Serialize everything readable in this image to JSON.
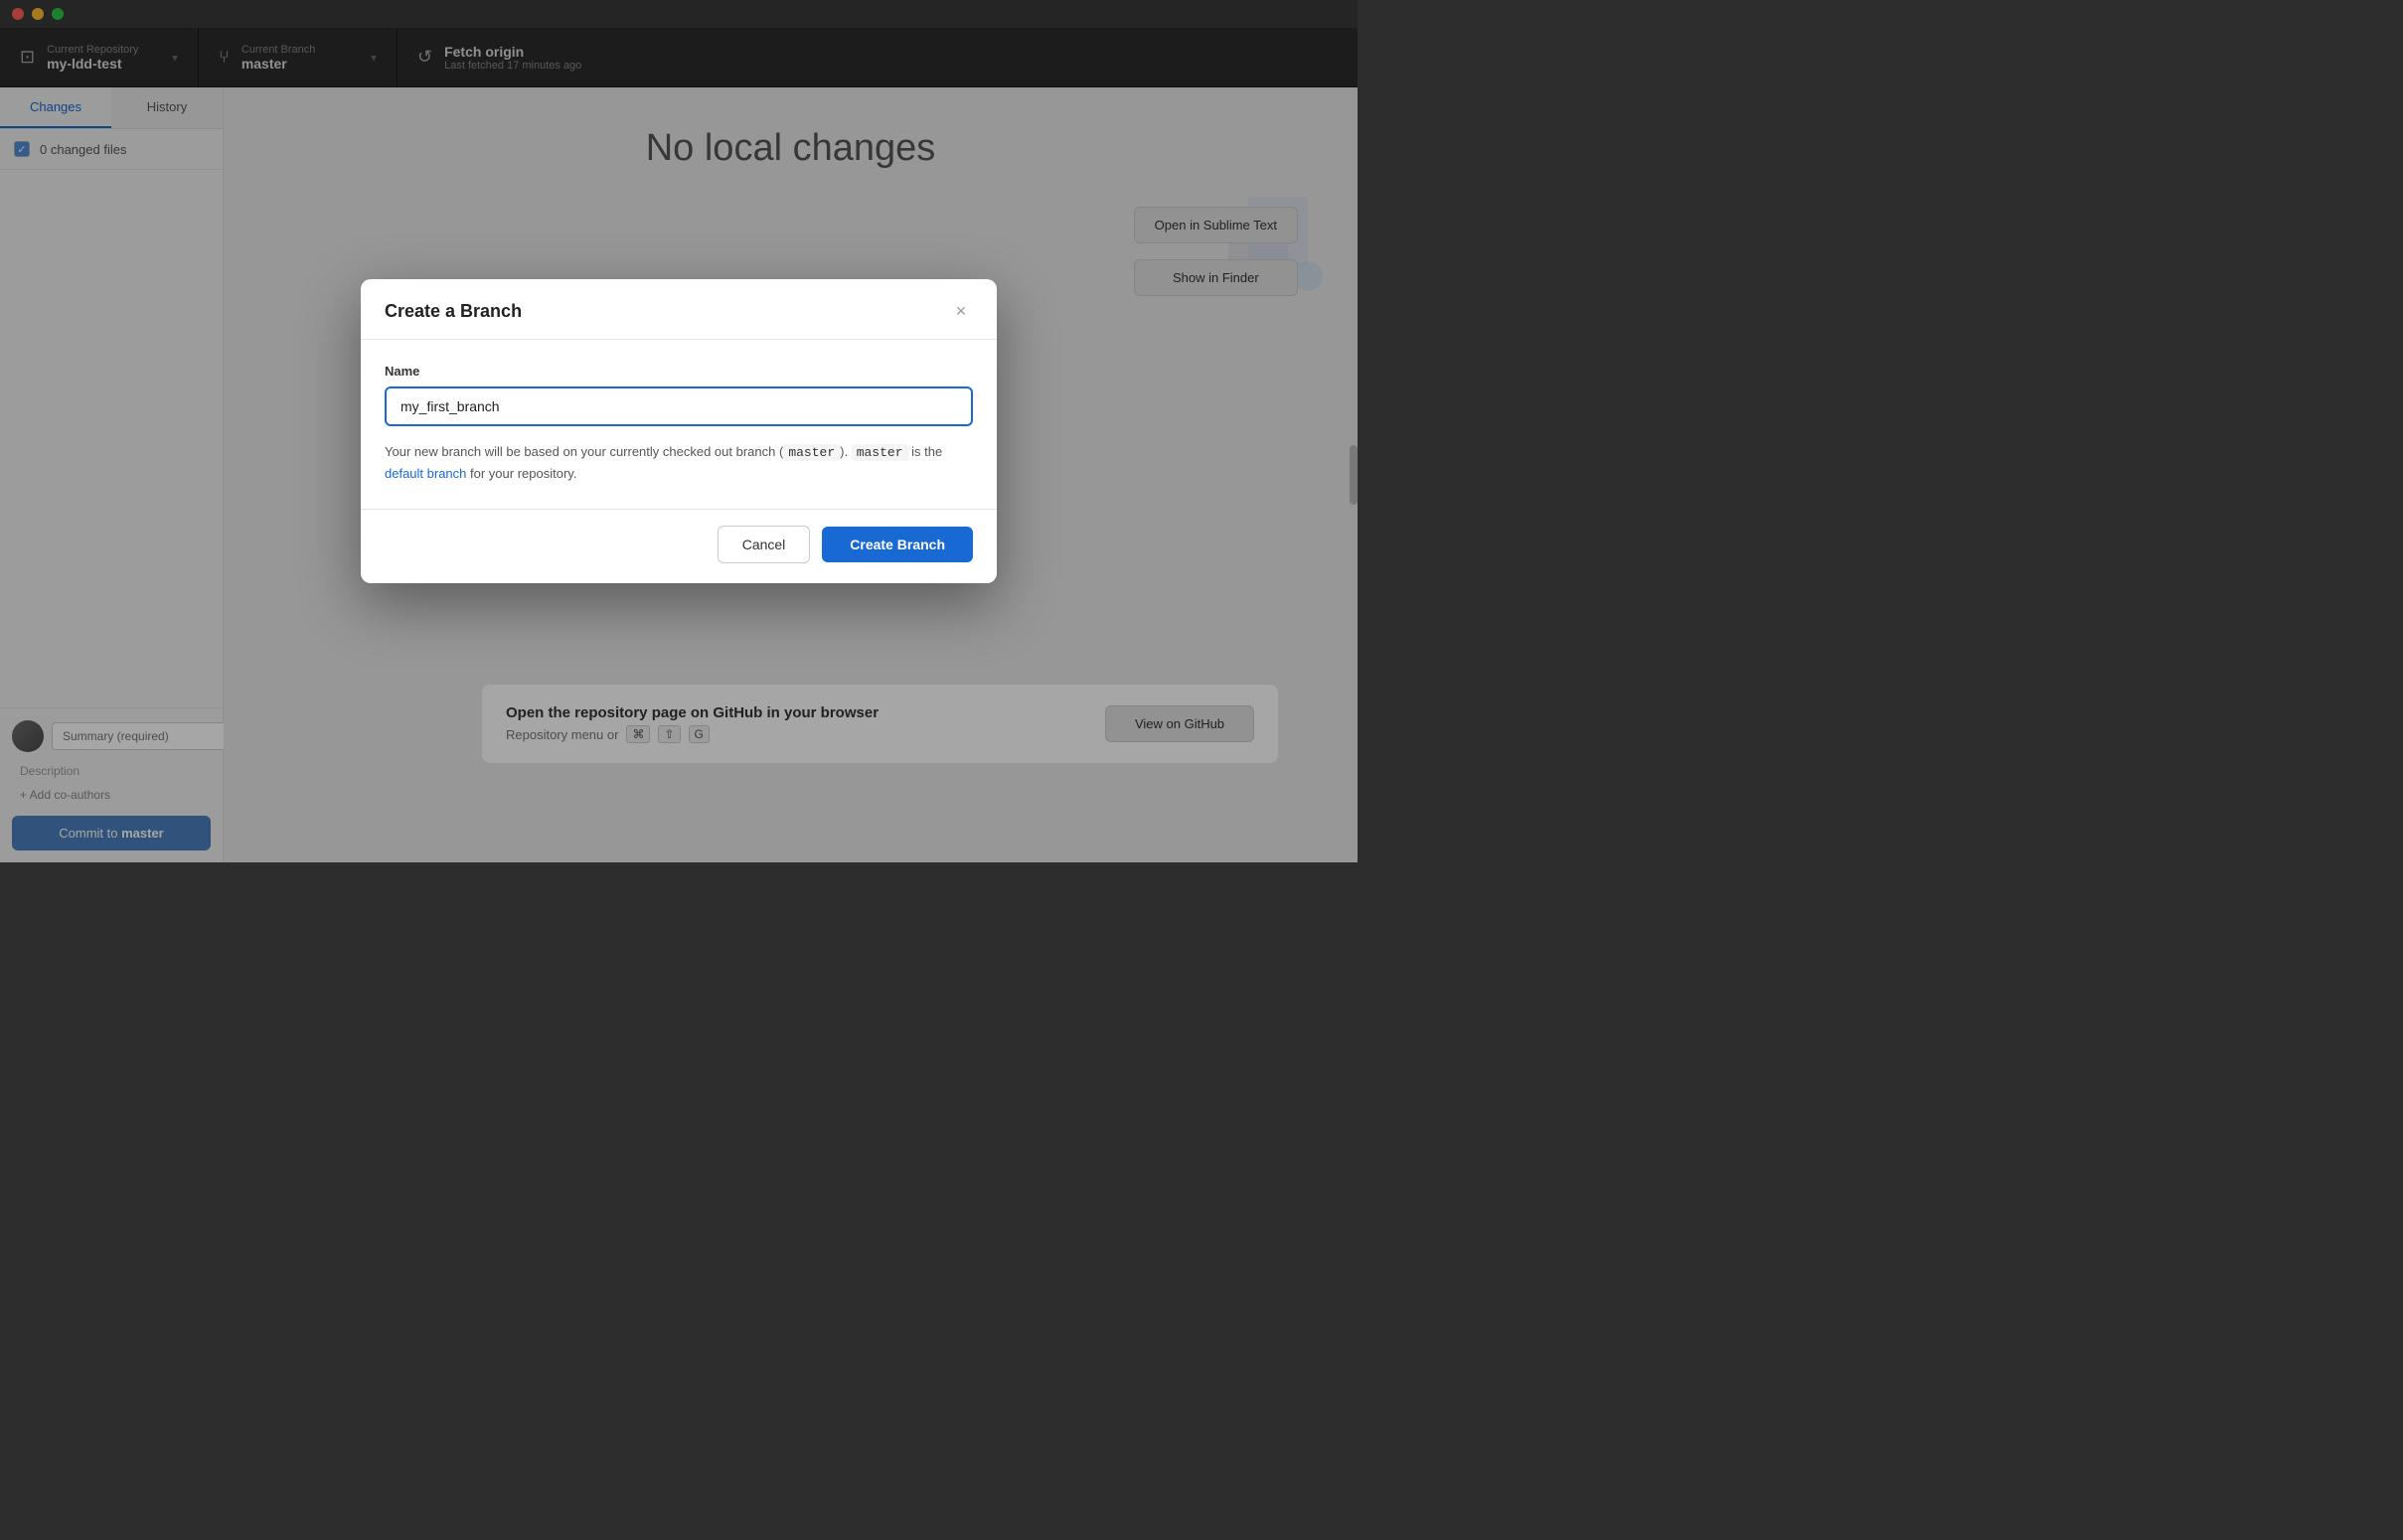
{
  "titlebar": {
    "buttons": [
      "close",
      "minimize",
      "maximize"
    ]
  },
  "toolbar": {
    "repo_section": {
      "label": "Current Repository",
      "value": "my-ldd-test",
      "chevron": "▾"
    },
    "branch_section": {
      "label": "Current Branch",
      "value": "master",
      "chevron": "▾"
    },
    "fetch_section": {
      "label": "Fetch origin",
      "sublabel": "Last fetched 17 minutes ago",
      "icon": "↺"
    }
  },
  "sidebar": {
    "tab_changes": "Changes",
    "tab_history": "History",
    "changed_files_count": "0 changed files",
    "summary_placeholder": "Summary (required)",
    "description_label": "Description",
    "add_coauthor_label": "+ Add co-authors",
    "commit_button_prefix": "Commit to ",
    "commit_button_branch": "master"
  },
  "main": {
    "no_changes_title": "No local changes",
    "open_sublime_label": "Open in Sublime Text",
    "show_finder_label": "Show in Finder",
    "repo_page_title": "Open the repository page on GitHub in your browser",
    "repo_page_sub": "Repository menu or",
    "repo_page_keys": [
      "⌘",
      "⇧",
      "G"
    ],
    "view_github_label": "View on GitHub"
  },
  "modal": {
    "title": "Create a Branch",
    "close_icon": "×",
    "name_label": "Name",
    "name_value": "my_first_branch",
    "info_text_1": "Your new branch will be based on your currently checked out branch (",
    "info_code_1": "master",
    "info_text_2": "). ",
    "info_code_2": "master",
    "info_text_3": " is the ",
    "info_link": "default branch",
    "info_text_4": " for your repository.",
    "cancel_label": "Cancel",
    "create_label": "Create Branch"
  }
}
